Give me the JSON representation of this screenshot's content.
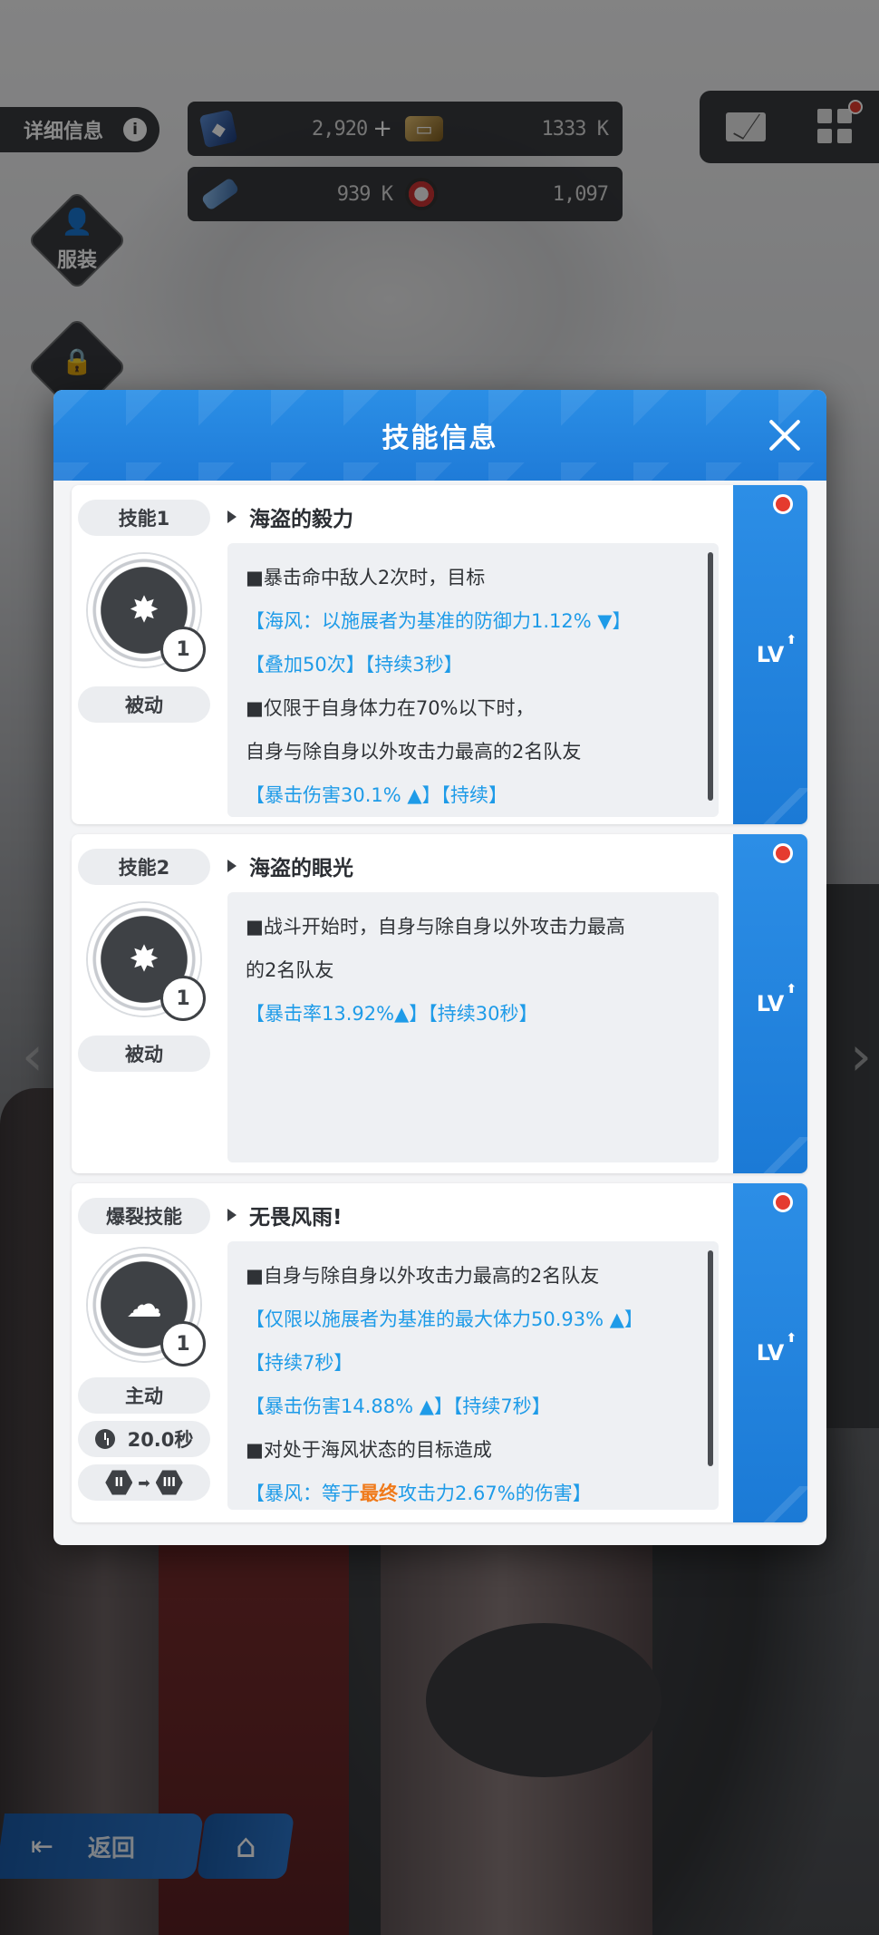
{
  "hud": {
    "info_label": "详细信息",
    "info_icon": "i",
    "resources": [
      {
        "icon": "gem-icon",
        "value": "2,920",
        "plus": "+"
      },
      {
        "icon": "card-icon",
        "value": "1333 K"
      },
      {
        "icon": "ticket-icon",
        "value": "939 K"
      },
      {
        "icon": "orb-icon",
        "value": "1,097"
      }
    ],
    "side_costume_label": "服装"
  },
  "nav": {
    "back_label": "返回"
  },
  "modal": {
    "title": "技能信息",
    "skills": [
      {
        "tag": "技能1",
        "name": "海盗的毅力",
        "level": "1",
        "type": "被动",
        "lv_label": "LV",
        "desc": [
          {
            "text": "■暴击命中敌人2次时，目标",
            "style": "normal"
          },
          {
            "text": "【海风：以施展者为基准的防御力1.12% ▼】",
            "style": "blue"
          },
          {
            "text": "【叠加50次】【持续3秒】",
            "style": "blue"
          },
          {
            "text": "■仅限于自身体力在70%以下时，",
            "style": "normal"
          },
          {
            "text": "自身与除自身以外攻击力最高的2名队友",
            "style": "normal"
          },
          {
            "text": "【暴击伤害30.1% ▲】【持续】",
            "style": "blue"
          }
        ]
      },
      {
        "tag": "技能2",
        "name": "海盗的眼光",
        "level": "1",
        "type": "被动",
        "lv_label": "LV",
        "desc": [
          {
            "text": "■战斗开始时，自身与除自身以外攻击力最高",
            "style": "normal"
          },
          {
            "text": "的2名队友",
            "style": "normal"
          },
          {
            "text": "【暴击率13.92%▲】【持续30秒】",
            "style": "blue"
          }
        ]
      },
      {
        "tag": "爆裂技能",
        "name": "无畏风雨!",
        "level": "1",
        "type": "主动",
        "cooldown": "20.0秒",
        "burst_from": "II",
        "burst_to": "III",
        "lv_label": "LV",
        "desc": [
          {
            "text": "■自身与除自身以外攻击力最高的2名队友",
            "style": "normal"
          },
          {
            "text": "【仅限以施展者为基准的最大体力50.93% ▲】",
            "style": "blue"
          },
          {
            "text": "【持续7秒】",
            "style": "blue"
          },
          {
            "text": "【暴击伤害14.88% ▲】【持续7秒】",
            "style": "blue"
          },
          {
            "text": "■对处于海风状态的目标造成",
            "style": "normal"
          },
          {
            "pre": "【暴风：等于",
            "highlight": "最终",
            "post": "攻击力2.67%的伤害】",
            "style": "blue"
          }
        ]
      }
    ]
  }
}
